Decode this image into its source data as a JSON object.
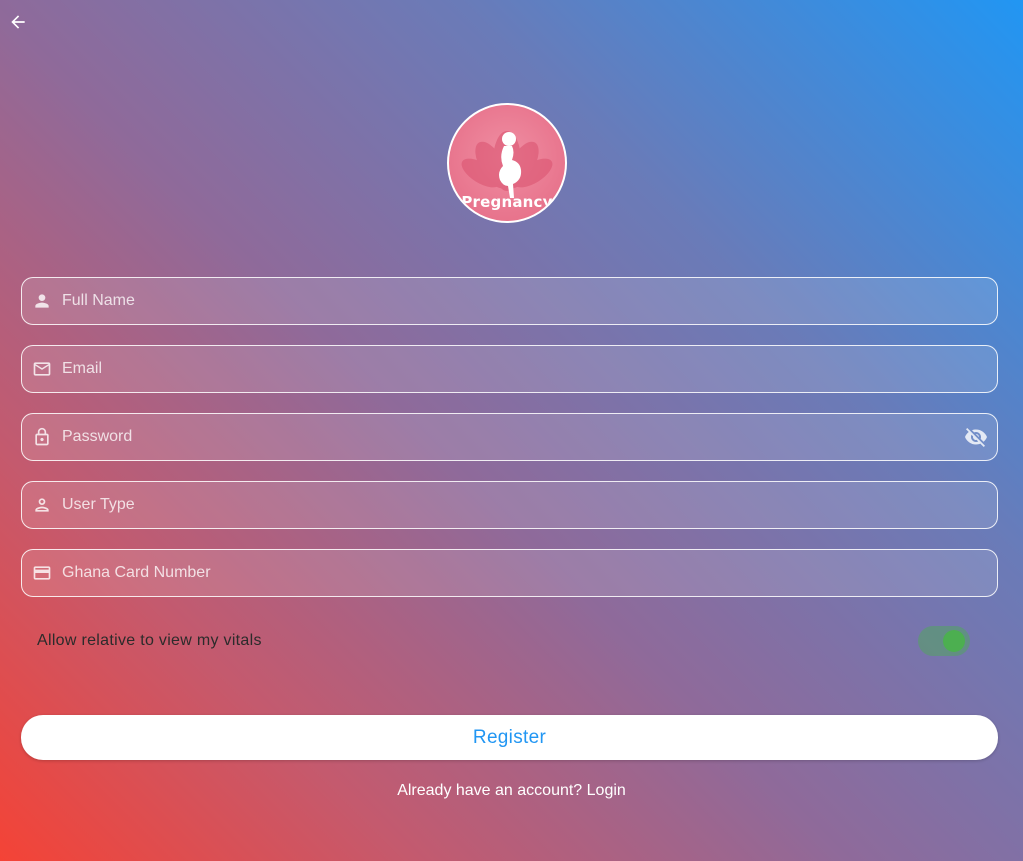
{
  "header": {
    "back_icon": "arrow-left-icon"
  },
  "logo": {
    "text": "Pregnancy"
  },
  "form": {
    "fields": [
      {
        "placeholder": "Full Name",
        "icon": "person-icon"
      },
      {
        "placeholder": "Email",
        "icon": "mail-icon"
      },
      {
        "placeholder": "Password",
        "icon": "lock-icon",
        "trailing_icon": "eye-off-icon"
      },
      {
        "placeholder": "User Type",
        "icon": "person-outline-icon"
      },
      {
        "placeholder": "Ghana Card Number",
        "icon": "credit-card-icon"
      }
    ],
    "toggle": {
      "label": "Allow relative to view my vitals",
      "on": true
    },
    "register_label": "Register",
    "login_text": "Already have an account? Login"
  },
  "colors": {
    "accent": "#2196f3",
    "gradient_start": "#f44336",
    "gradient_end": "#2196f3",
    "switch_on": "#4caf50"
  }
}
